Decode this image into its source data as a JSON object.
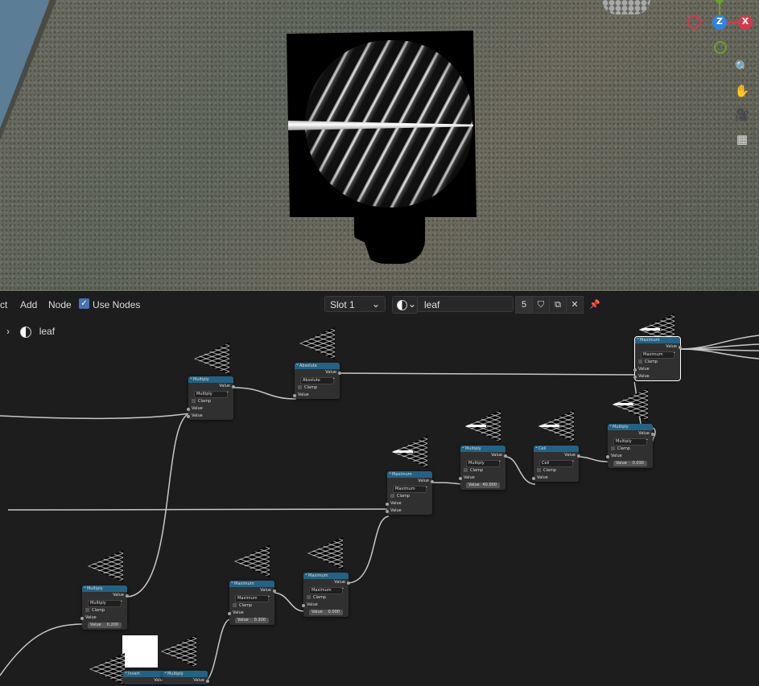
{
  "header": {
    "menus": [
      "ct",
      "Add",
      "Node"
    ],
    "use_nodes_label": "Use Nodes",
    "slot_label": "Slot 1",
    "material_name": "leaf",
    "user_count": "5"
  },
  "breadcrumb": {
    "material": "leaf"
  },
  "gizmo": {
    "z_label": "Z",
    "x_label": "X"
  },
  "nodes": {
    "multiply": "Multiply",
    "absolute": "Absolute",
    "maximum": "Maximum",
    "ceil": "Ceil",
    "invert": "Invert",
    "value": "Value",
    "clamp": "Clamp",
    "val_40000": "40.000",
    "val_0200": "0.200",
    "val_0300": "0.300",
    "val_0000": "0.000",
    "val_0030": "0.030"
  },
  "colors": {
    "node_header": "#246283",
    "checkbox": "#4772b3",
    "axis_x": "#d4394d",
    "axis_y": "#6aa322",
    "axis_z": "#2f83e3"
  }
}
